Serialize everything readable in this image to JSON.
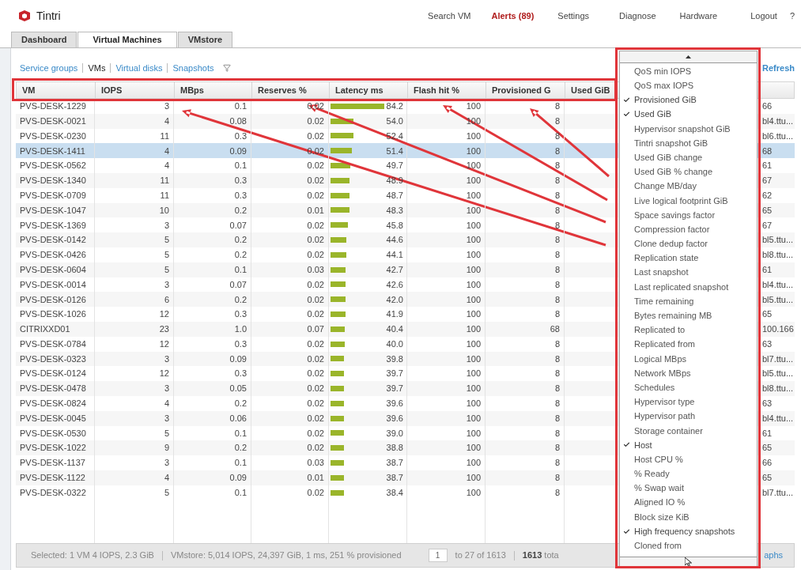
{
  "header": {
    "logo_text": "Tintri",
    "nav": [
      {
        "label": "Search VM",
        "kind": "link"
      },
      {
        "label": "Alerts (89)",
        "kind": "alert"
      },
      {
        "label": "Settings",
        "kind": "link"
      },
      {
        "label": "Diagnose",
        "kind": "link"
      },
      {
        "label": "Hardware",
        "kind": "link"
      },
      {
        "label": "Logout",
        "kind": "link"
      },
      {
        "label": "?",
        "kind": "link"
      }
    ]
  },
  "tabs": [
    {
      "label": "Dashboard",
      "selected": false
    },
    {
      "label": "Virtual Machines",
      "selected": true
    },
    {
      "label": "VMstore",
      "selected": false
    }
  ],
  "subnav": {
    "links": [
      {
        "label": "Service groups",
        "selected": false
      },
      {
        "label": "VMs",
        "selected": true
      },
      {
        "label": "Virtual disks",
        "selected": false
      },
      {
        "label": "Snapshots",
        "selected": false
      }
    ],
    "refresh": "Refresh"
  },
  "table": {
    "columns": [
      "VM",
      "IOPS",
      "MBps",
      "Reserves %",
      "Latency ms",
      "Flash hit %",
      "Provisioned G",
      "Used GiB"
    ],
    "rows": [
      {
        "vm": "PVS-DESK-1229",
        "iops": "3",
        "mbps": "0.1",
        "reserves": "0.02",
        "latency": "84.2",
        "level": 0.69,
        "flash_hit": "100",
        "provisioned": "8",
        "column_9": "66",
        "selected": false
      },
      {
        "vm": "PVS-DESK-0021",
        "iops": "4",
        "mbps": "0.08",
        "reserves": "0.02",
        "latency": "54.0",
        "level": 0.29,
        "flash_hit": "100",
        "provisioned": "8",
        "column_9": "bl4.ttu...",
        "selected": false
      },
      {
        "vm": "PVS-DESK-0230",
        "iops": "11",
        "mbps": "0.3",
        "reserves": "0.02",
        "latency": "52.4",
        "level": 0.29,
        "flash_hit": "100",
        "provisioned": "8",
        "column_9": "bl6.ttu...",
        "selected": false
      },
      {
        "vm": "PVS-DESK-1411",
        "iops": "4",
        "mbps": "0.09",
        "reserves": "0.02",
        "latency": "51.4",
        "level": 0.27,
        "flash_hit": "100",
        "provisioned": "8",
        "column_9": "68",
        "selected": true
      },
      {
        "vm": "PVS-DESK-0562",
        "iops": "4",
        "mbps": "0.1",
        "reserves": "0.02",
        "latency": "49.7",
        "level": 0.25,
        "flash_hit": "100",
        "provisioned": "8",
        "column_9": "61",
        "selected": false
      },
      {
        "vm": "PVS-DESK-1340",
        "iops": "11",
        "mbps": "0.3",
        "reserves": "0.02",
        "latency": "48.9",
        "level": 0.24,
        "flash_hit": "100",
        "provisioned": "8",
        "column_9": "67",
        "selected": false
      },
      {
        "vm": "PVS-DESK-0709",
        "iops": "11",
        "mbps": "0.3",
        "reserves": "0.02",
        "latency": "48.7",
        "level": 0.24,
        "flash_hit": "100",
        "provisioned": "8",
        "column_9": "62",
        "selected": false
      },
      {
        "vm": "PVS-DESK-1047",
        "iops": "10",
        "mbps": "0.2",
        "reserves": "0.01",
        "latency": "48.3",
        "level": 0.24,
        "flash_hit": "100",
        "provisioned": "8",
        "column_9": "65",
        "selected": false
      },
      {
        "vm": "PVS-DESK-1369",
        "iops": "3",
        "mbps": "0.07",
        "reserves": "0.02",
        "latency": "45.8",
        "level": 0.22,
        "flash_hit": "100",
        "provisioned": "8",
        "column_9": "67",
        "selected": false
      },
      {
        "vm": "PVS-DESK-0142",
        "iops": "5",
        "mbps": "0.2",
        "reserves": "0.02",
        "latency": "44.6",
        "level": 0.2,
        "flash_hit": "100",
        "provisioned": "8",
        "column_9": "bl5.ttu...",
        "selected": false
      },
      {
        "vm": "PVS-DESK-0426",
        "iops": "5",
        "mbps": "0.2",
        "reserves": "0.02",
        "latency": "44.1",
        "level": 0.2,
        "flash_hit": "100",
        "provisioned": "8",
        "column_9": "bl8.ttu...",
        "selected": false
      },
      {
        "vm": "PVS-DESK-0604",
        "iops": "5",
        "mbps": "0.1",
        "reserves": "0.03",
        "latency": "42.7",
        "level": 0.19,
        "flash_hit": "100",
        "provisioned": "8",
        "column_9": "61",
        "selected": false
      },
      {
        "vm": "PVS-DESK-0014",
        "iops": "3",
        "mbps": "0.07",
        "reserves": "0.02",
        "latency": "42.6",
        "level": 0.19,
        "flash_hit": "100",
        "provisioned": "8",
        "column_9": "bl4.ttu...",
        "selected": false
      },
      {
        "vm": "PVS-DESK-0126",
        "iops": "6",
        "mbps": "0.2",
        "reserves": "0.02",
        "latency": "42.0",
        "level": 0.19,
        "flash_hit": "100",
        "provisioned": "8",
        "column_9": "bl5.ttu...",
        "selected": false
      },
      {
        "vm": "PVS-DESK-1026",
        "iops": "12",
        "mbps": "0.3",
        "reserves": "0.02",
        "latency": "41.9",
        "level": 0.19,
        "flash_hit": "100",
        "provisioned": "8",
        "column_9": "65",
        "selected": false
      },
      {
        "vm": "CITRIXXD01",
        "iops": "23",
        "mbps": "1.0",
        "reserves": "0.07",
        "latency": "40.4",
        "level": 0.18,
        "flash_hit": "100",
        "provisioned": "68",
        "column_9": "100.166",
        "selected": false
      },
      {
        "vm": "PVS-DESK-0784",
        "iops": "12",
        "mbps": "0.3",
        "reserves": "0.02",
        "latency": "40.0",
        "level": 0.18,
        "flash_hit": "100",
        "provisioned": "8",
        "column_9": "63",
        "selected": false
      },
      {
        "vm": "PVS-DESK-0323",
        "iops": "3",
        "mbps": "0.09",
        "reserves": "0.02",
        "latency": "39.8",
        "level": 0.17,
        "flash_hit": "100",
        "provisioned": "8",
        "column_9": "bl7.ttu...",
        "selected": false
      },
      {
        "vm": "PVS-DESK-0124",
        "iops": "12",
        "mbps": "0.3",
        "reserves": "0.02",
        "latency": "39.7",
        "level": 0.17,
        "flash_hit": "100",
        "provisioned": "8",
        "column_9": "bl5.ttu...",
        "selected": false
      },
      {
        "vm": "PVS-DESK-0478",
        "iops": "3",
        "mbps": "0.05",
        "reserves": "0.02",
        "latency": "39.7",
        "level": 0.17,
        "flash_hit": "100",
        "provisioned": "8",
        "column_9": "bl8.ttu...",
        "selected": false
      },
      {
        "vm": "PVS-DESK-0824",
        "iops": "4",
        "mbps": "0.2",
        "reserves": "0.02",
        "latency": "39.6",
        "level": 0.17,
        "flash_hit": "100",
        "provisioned": "8",
        "column_9": "63",
        "selected": false
      },
      {
        "vm": "PVS-DESK-0045",
        "iops": "3",
        "mbps": "0.06",
        "reserves": "0.02",
        "latency": "39.6",
        "level": 0.17,
        "flash_hit": "100",
        "provisioned": "8",
        "column_9": "bl4.ttu...",
        "selected": false
      },
      {
        "vm": "PVS-DESK-0530",
        "iops": "5",
        "mbps": "0.1",
        "reserves": "0.02",
        "latency": "39.0",
        "level": 0.17,
        "flash_hit": "100",
        "provisioned": "8",
        "column_9": "61",
        "selected": false
      },
      {
        "vm": "PVS-DESK-1022",
        "iops": "9",
        "mbps": "0.2",
        "reserves": "0.02",
        "latency": "38.8",
        "level": 0.17,
        "flash_hit": "100",
        "provisioned": "8",
        "column_9": "65",
        "selected": false
      },
      {
        "vm": "PVS-DESK-1137",
        "iops": "3",
        "mbps": "0.1",
        "reserves": "0.03",
        "latency": "38.7",
        "level": 0.17,
        "flash_hit": "100",
        "provisioned": "8",
        "column_9": "66",
        "selected": false
      },
      {
        "vm": "PVS-DESK-1122",
        "iops": "4",
        "mbps": "0.09",
        "reserves": "0.01",
        "latency": "38.7",
        "level": 0.17,
        "flash_hit": "100",
        "provisioned": "8",
        "column_9": "65",
        "selected": false
      },
      {
        "vm": "PVS-DESK-0322",
        "iops": "5",
        "mbps": "0.1",
        "reserves": "0.02",
        "latency": "38.4",
        "level": 0.17,
        "flash_hit": "100",
        "provisioned": "8",
        "column_9": "bl7.ttu...",
        "selected": false
      }
    ]
  },
  "footer": {
    "selected_summary": "Selected: 1 VM 4 IOPS, 2.3 GiB",
    "vmstore_summary": "VMstore: 5,014 IOPS, 24,397 GiB, 1 ms, 251 % provisioned",
    "page": "1",
    "range": "to 27 of 1613",
    "total": "**1613** tota",
    "graphs": "aphs"
  },
  "column_menu": {
    "items": [
      {
        "label": "QoS min IOPS",
        "checked": false
      },
      {
        "label": "QoS max IOPS",
        "checked": false
      },
      {
        "label": "Provisioned GiB",
        "checked": true
      },
      {
        "label": "Used GiB",
        "checked": true
      },
      {
        "label": "Hypervisor snapshot GiB",
        "checked": false
      },
      {
        "label": "Tintri snapshot GiB",
        "checked": false
      },
      {
        "label": "Used GiB change",
        "checked": false
      },
      {
        "label": "Used GiB % change",
        "checked": false
      },
      {
        "label": "Change MB/day",
        "checked": false
      },
      {
        "label": "Live logical footprint GiB",
        "checked": false
      },
      {
        "label": "Space savings factor",
        "checked": false
      },
      {
        "label": "Compression factor",
        "checked": false
      },
      {
        "label": "Clone dedup factor",
        "checked": false
      },
      {
        "label": "Replication state",
        "checked": false
      },
      {
        "label": "Last snapshot",
        "checked": false
      },
      {
        "label": "Last replicated snapshot",
        "checked": false
      },
      {
        "label": "Time remaining",
        "checked": false
      },
      {
        "label": "Bytes remaining MB",
        "checked": false
      },
      {
        "label": "Replicated to",
        "checked": false
      },
      {
        "label": "Replicated from",
        "checked": false
      },
      {
        "label": "Logical MBps",
        "checked": false
      },
      {
        "label": "Network MBps",
        "checked": false
      },
      {
        "label": "Schedules",
        "checked": false
      },
      {
        "label": "Hypervisor type",
        "checked": false
      },
      {
        "label": "Hypervisor path",
        "checked": false
      },
      {
        "label": "Storage container",
        "checked": false
      },
      {
        "label": "Host",
        "checked": true
      },
      {
        "label": "Host CPU %",
        "checked": false
      },
      {
        "label": "% Ready",
        "checked": false
      },
      {
        "label": "% Swap wait",
        "checked": false
      },
      {
        "label": "Aligned IO %",
        "checked": false
      },
      {
        "label": "Block size KiB",
        "checked": false
      },
      {
        "label": "High frequency snapshots",
        "checked": true
      },
      {
        "label": "Cloned from",
        "checked": false
      }
    ]
  }
}
